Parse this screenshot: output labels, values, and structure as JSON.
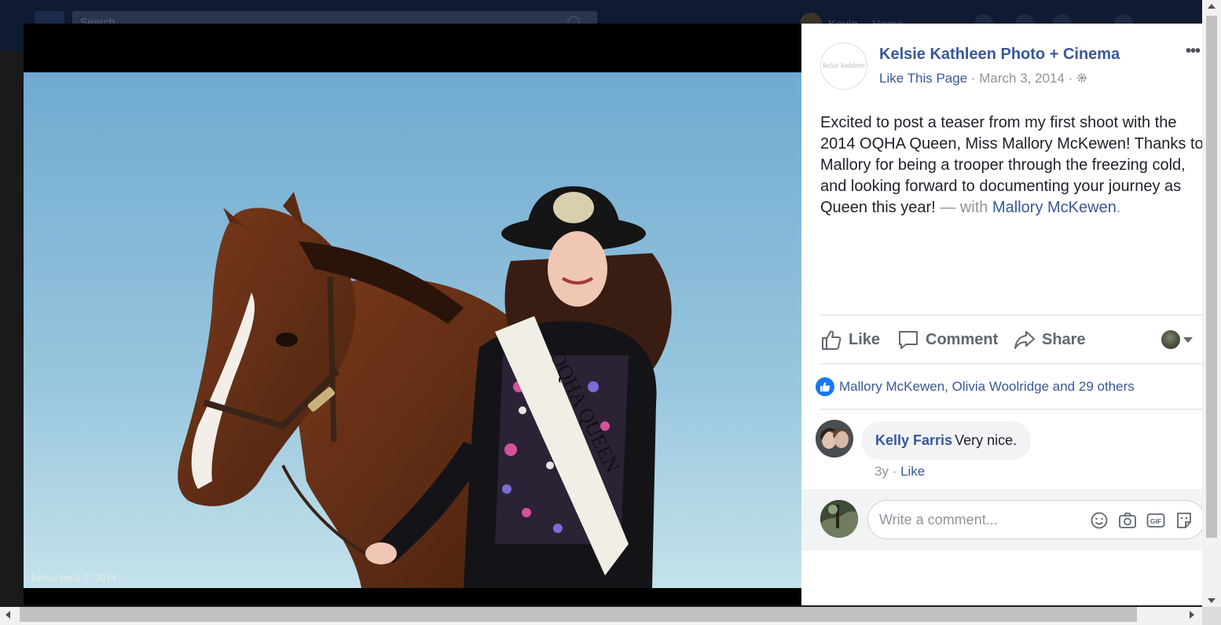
{
  "topbar": {
    "search_placeholder": "Search",
    "user_name": "Kevin",
    "home_label": "Home",
    "icons": [
      "facebook-logo-icon",
      "search-icon",
      "friend-requests-icon",
      "messages-icon",
      "notifications-icon",
      "help-icon"
    ]
  },
  "photo": {
    "watermark": "kelsie beck © 2014",
    "sash_text": "OQHA QUEEN"
  },
  "post": {
    "page_avatar_text": "kelsie kathleen",
    "page_name": "Kelsie Kathleen Photo + Cinema",
    "like_page": "Like This Page",
    "separator": " · ",
    "date": "March 3, 2014",
    "privacy_icon": "gear-icon",
    "more_label": "•••",
    "text_main": "Excited to post a teaser from my first shoot with the 2014 OQHA Queen, Miss Mallory McKewen! Thanks to Mallory for being a trooper through the freezing cold, and looking forward to documenting your journey as Queen this year!",
    "with_label": " — with ",
    "tagged_person": "Mallory McKewen",
    "period": "."
  },
  "actions": {
    "like": "Like",
    "comment": "Comment",
    "share": "Share"
  },
  "reactions": {
    "summary": "Mallory McKewen, Olivia Woolridge and 29 others"
  },
  "comments": [
    {
      "author": "Kelly Farris",
      "text": "Very nice.",
      "age": "3y",
      "dot": " · ",
      "like": "Like"
    }
  ],
  "composer": {
    "placeholder": "Write a comment...",
    "gif_label": "GIF"
  },
  "colors": {
    "link": "#385898",
    "facebook_blue": "#1877f2",
    "muted": "#90949c",
    "text": "#1d2129"
  }
}
